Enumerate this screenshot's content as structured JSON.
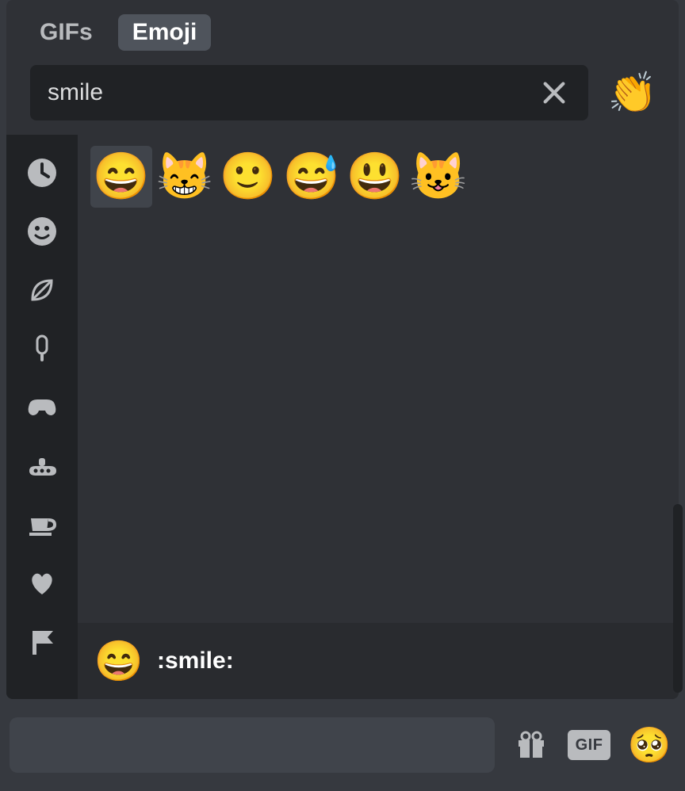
{
  "tabs": {
    "gifs": "GIFs",
    "emoji": "Emoji"
  },
  "search": {
    "value": "smile",
    "placeholder": ""
  },
  "skin_tone_emoji": "👏",
  "categories": [
    {
      "id": "recent",
      "active": true
    },
    {
      "id": "smileys"
    },
    {
      "id": "nature"
    },
    {
      "id": "food"
    },
    {
      "id": "activities"
    },
    {
      "id": "travel"
    },
    {
      "id": "objects"
    },
    {
      "id": "symbols"
    },
    {
      "id": "flags"
    }
  ],
  "results": [
    {
      "emoji": "😄",
      "name": ":smile:",
      "selected": true
    },
    {
      "emoji": "😸",
      "name": ":smile_cat:"
    },
    {
      "emoji": "🙂",
      "name": ":slight_smile:"
    },
    {
      "emoji": "😅",
      "name": ":sweat_smile:"
    },
    {
      "emoji": "😃",
      "name": ":smiley:"
    },
    {
      "emoji": "😺",
      "name": ":smiley_cat:"
    }
  ],
  "preview": {
    "emoji": "😄",
    "name": ":smile:"
  },
  "bottom": {
    "gif_label": "GIF",
    "face_emoji": "🥺"
  }
}
